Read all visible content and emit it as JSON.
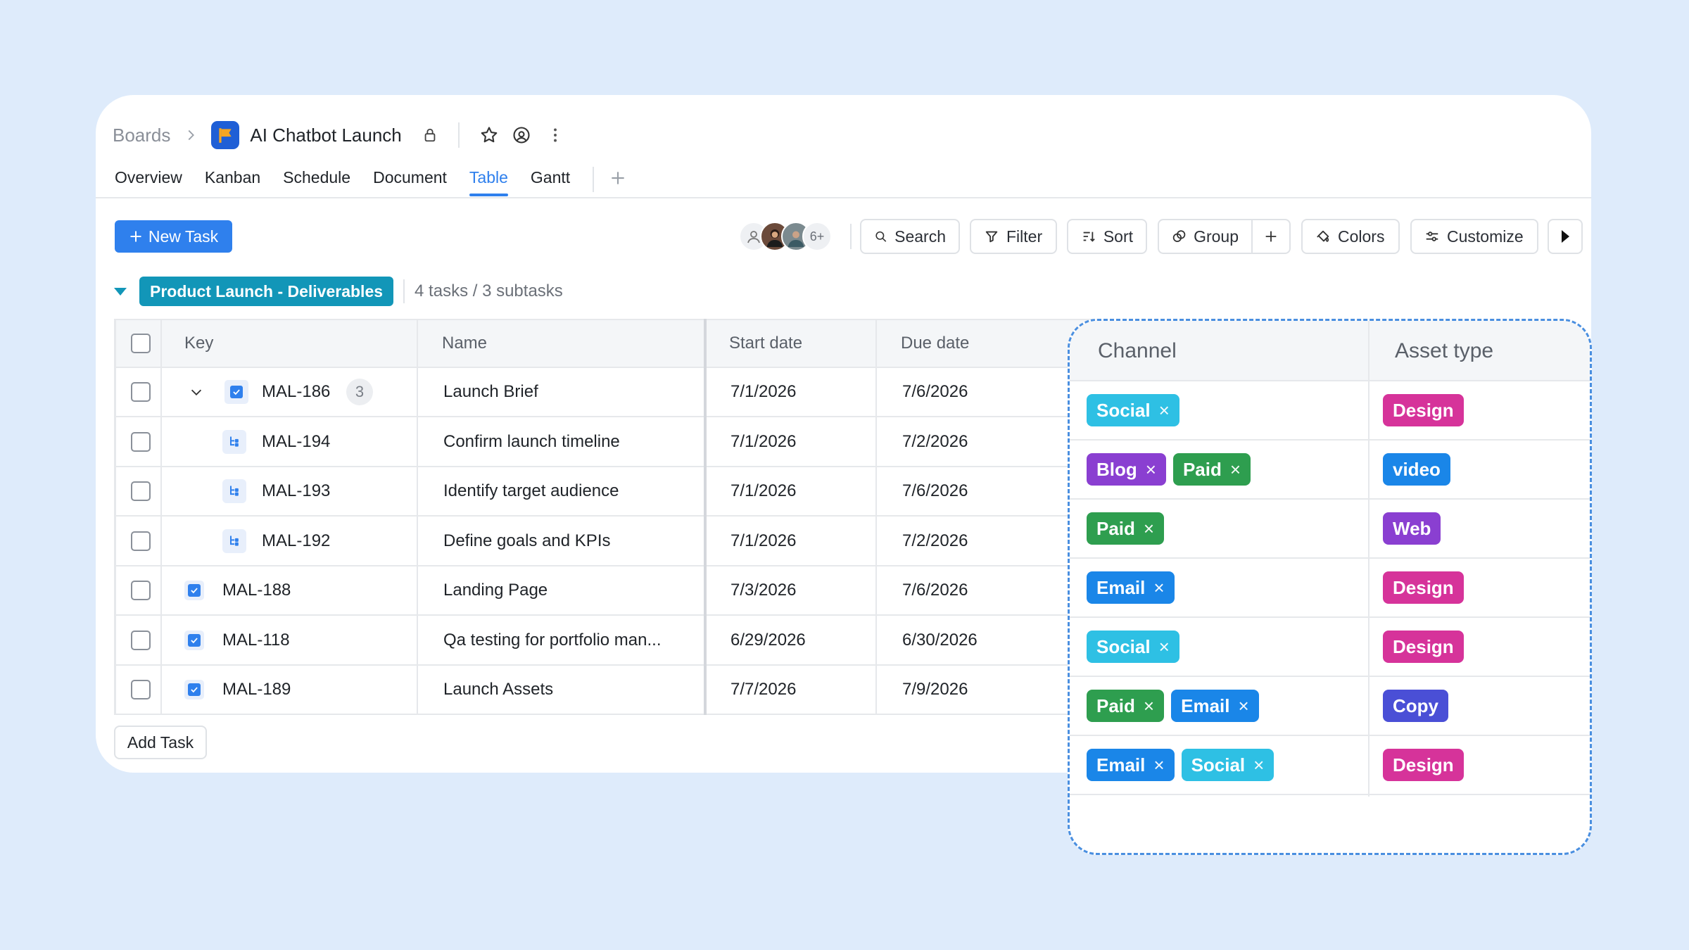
{
  "header": {
    "breadcrumb_root": "Boards",
    "project_title": "AI Chatbot Launch"
  },
  "tabs": [
    {
      "label": "Overview",
      "active": false
    },
    {
      "label": "Kanban",
      "active": false
    },
    {
      "label": "Schedule",
      "active": false
    },
    {
      "label": "Document",
      "active": false
    },
    {
      "label": "Table",
      "active": true
    },
    {
      "label": "Gantt",
      "active": false
    }
  ],
  "toolbar": {
    "new_task_label": "New Task",
    "members_more": "6+",
    "search_label": "Search",
    "filter_label": "Filter",
    "sort_label": "Sort",
    "group_label": "Group",
    "colors_label": "Colors",
    "customize_label": "Customize"
  },
  "group": {
    "name": "Product Launch - Deliverables",
    "summary": "4 tasks / 3 subtasks"
  },
  "table": {
    "columns": {
      "key": "Key",
      "name": "Name",
      "start": "Start date",
      "due": "Due date"
    },
    "rows": [
      {
        "key": "MAL-186",
        "name": "Launch Brief",
        "start": "7/1/2026",
        "due": "7/6/2026",
        "subtask_count": "3"
      },
      {
        "key": "MAL-194",
        "name": "Confirm launch timeline",
        "start": "7/1/2026",
        "due": "7/2/2026"
      },
      {
        "key": "MAL-193",
        "name": "Identify target audience",
        "start": "7/1/2026",
        "due": "7/6/2026"
      },
      {
        "key": "MAL-192",
        "name": "Define goals and KPIs",
        "start": "7/1/2026",
        "due": "7/2/2026"
      },
      {
        "key": "MAL-188",
        "name": "Landing Page",
        "start": "7/3/2026",
        "due": "7/6/2026"
      },
      {
        "key": "MAL-118",
        "name": "Qa testing for portfolio man...",
        "start": "6/29/2026",
        "due": "6/30/2026"
      },
      {
        "key": "MAL-189",
        "name": "Launch Assets",
        "start": "7/7/2026",
        "due": "7/9/2026"
      }
    ],
    "add_task_label": "Add Task"
  },
  "panel": {
    "columns": {
      "channel": "Channel",
      "asset_type": "Asset type"
    },
    "rows": [
      {
        "channels": [
          "Social"
        ],
        "asset": "Design"
      },
      {
        "channels": [
          "Blog",
          "Paid"
        ],
        "asset": "video"
      },
      {
        "channels": [
          "Paid"
        ],
        "asset": "Web"
      },
      {
        "channels": [
          "Email"
        ],
        "asset": "Design"
      },
      {
        "channels": [
          "Social"
        ],
        "asset": "Design"
      },
      {
        "channels": [
          "Paid",
          "Email"
        ],
        "asset": "Copy"
      },
      {
        "channels": [
          "Email",
          "Social"
        ],
        "asset": "Design"
      }
    ],
    "remove_glyph": "×"
  },
  "colors": {
    "accent": "#2f80ed",
    "group_badge": "#1296b8",
    "tag_social": "#2ec0e4",
    "tag_blog": "#8a3fd1",
    "tag_paid": "#2e9e4f",
    "tag_email": "#1a86e8",
    "asset_design": "#d6339a",
    "asset_video": "#1a86e8",
    "asset_web": "#8a3fd1",
    "asset_copy": "#4a4fd6"
  }
}
